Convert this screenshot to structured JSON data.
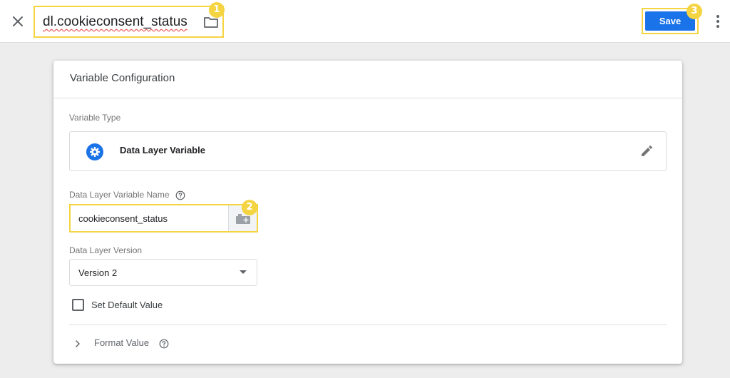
{
  "header": {
    "variable_name": "dl.cookieconsent_status",
    "save_label": "Save",
    "icons": {
      "close": "close-icon",
      "folder": "folder-icon",
      "more": "more-vert-icon"
    }
  },
  "callouts": {
    "one": "1",
    "two": "2",
    "three": "3",
    "color": "#f5d442"
  },
  "config": {
    "title": "Variable Configuration",
    "variable_type_label": "Variable Type",
    "variable_type_name": "Data Layer Variable",
    "dlv_name_label": "Data Layer Variable Name",
    "dlv_name_value": "cookieconsent_status",
    "dl_version_label": "Data Layer Version",
    "dl_version_value": "Version 2",
    "default_value_label": "Set Default Value",
    "default_value_checked": false,
    "format_value_label": "Format Value"
  },
  "colors": {
    "accent": "#1a73e8",
    "highlight": "#f5d442"
  }
}
